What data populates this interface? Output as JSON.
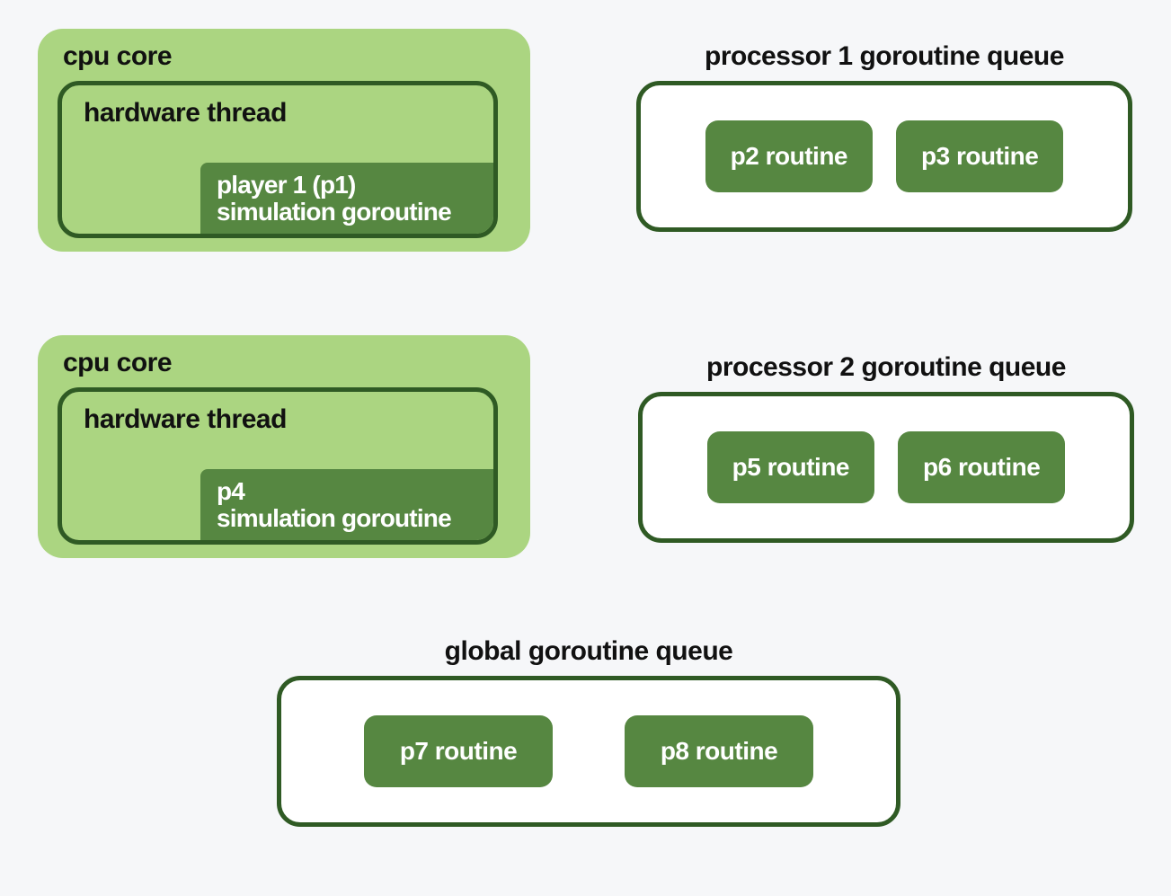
{
  "cores": [
    {
      "title": "cpu core",
      "thread_title": "hardware thread",
      "running_line1": "player 1 (p1)",
      "running_line2": "simulation goroutine"
    },
    {
      "title": "cpu core",
      "thread_title": "hardware thread",
      "running_line1": "p4",
      "running_line2": "simulation goroutine"
    }
  ],
  "queues": [
    {
      "title": "processor 1 goroutine queue",
      "items": [
        "p2 routine",
        "p3 routine"
      ]
    },
    {
      "title": "processor 2 goroutine queue",
      "items": [
        "p5 routine",
        "p6 routine"
      ]
    },
    {
      "title": "global goroutine queue",
      "items": [
        "p7 routine",
        "p8 routine"
      ]
    }
  ]
}
